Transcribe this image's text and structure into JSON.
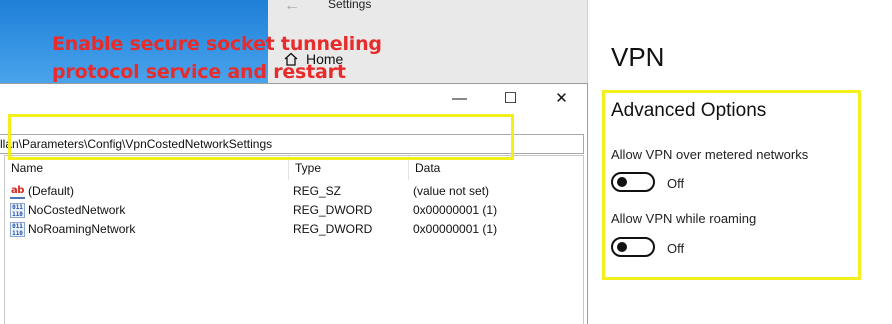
{
  "settings": {
    "title": "Settings",
    "home_label": "Home"
  },
  "annotation": {
    "line1": "Enable secure socket tunneling",
    "line2": "protocol service and restart"
  },
  "regedit": {
    "controls": {
      "minimize": "—",
      "maximize": "☐",
      "close": "✕"
    },
    "address": "llan\\Parameters\\Config\\VpnCostedNetworkSettings",
    "columns": {
      "name": "Name",
      "type": "Type",
      "data": "Data"
    },
    "rows": [
      {
        "icon": "ab",
        "name": "(Default)",
        "type": "REG_SZ",
        "data": "(value not set)"
      },
      {
        "icon": "bin",
        "name": "NoCostedNetwork",
        "type": "REG_DWORD",
        "data": "0x00000001 (1)"
      },
      {
        "icon": "bin",
        "name": "NoRoamingNetwork",
        "type": "REG_DWORD",
        "data": "0x00000001 (1)"
      }
    ]
  },
  "vpn": {
    "title": "VPN",
    "advanced_title": "Advanced Options",
    "options": [
      {
        "label": "Allow VPN over metered networks",
        "state": "Off"
      },
      {
        "label": "Allow VPN while roaming",
        "state": "Off"
      }
    ]
  },
  "colors": {
    "annotation": "#e82b2b",
    "highlight": "#f3ef1b"
  }
}
